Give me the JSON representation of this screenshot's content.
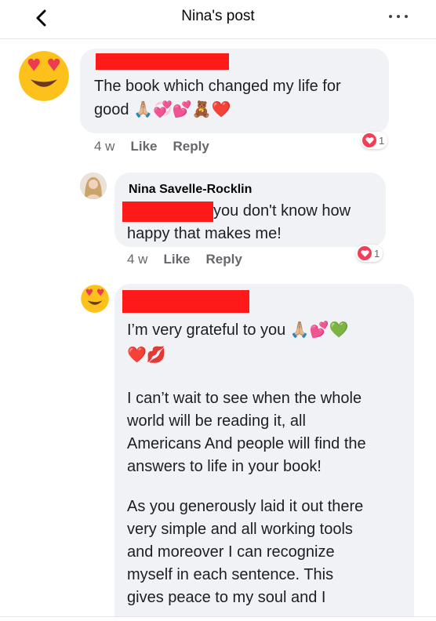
{
  "header": {
    "title": "Nina's post"
  },
  "comments": [
    {
      "text_line1": "The book which changed my life for",
      "text_line2": "good",
      "emojis": "🙏🏼💞💕🧸❤️",
      "time": "4 w",
      "like": "Like",
      "reply": "Reply",
      "reaction_count": "1"
    },
    {
      "author": "Nina Savelle-Rocklin",
      "text_line1": "you don't know how",
      "text_line2": "happy that makes me!",
      "time": "4 w",
      "like": "Like",
      "reply": "Reply",
      "reaction_count": "1"
    },
    {
      "line1": "I’m very grateful to you",
      "line1_emojis": "🙏🏼💕💚",
      "line2_emojis": "❤️💋",
      "para2": [
        "I can’t wait to see when the whole",
        "world will be reading it, all",
        "Americans And people will find the",
        "answers to life in your book!"
      ],
      "para3": [
        "As you generously laid it out there",
        "very simple and all working tools",
        "and moreover I can recognize",
        "myself in each sentence. This",
        "gives peace to my soul and I"
      ]
    }
  ],
  "colors": {
    "redaction": "#ff1a1a",
    "bubble": "#f0f2f5",
    "reaction": "#f33e58"
  }
}
